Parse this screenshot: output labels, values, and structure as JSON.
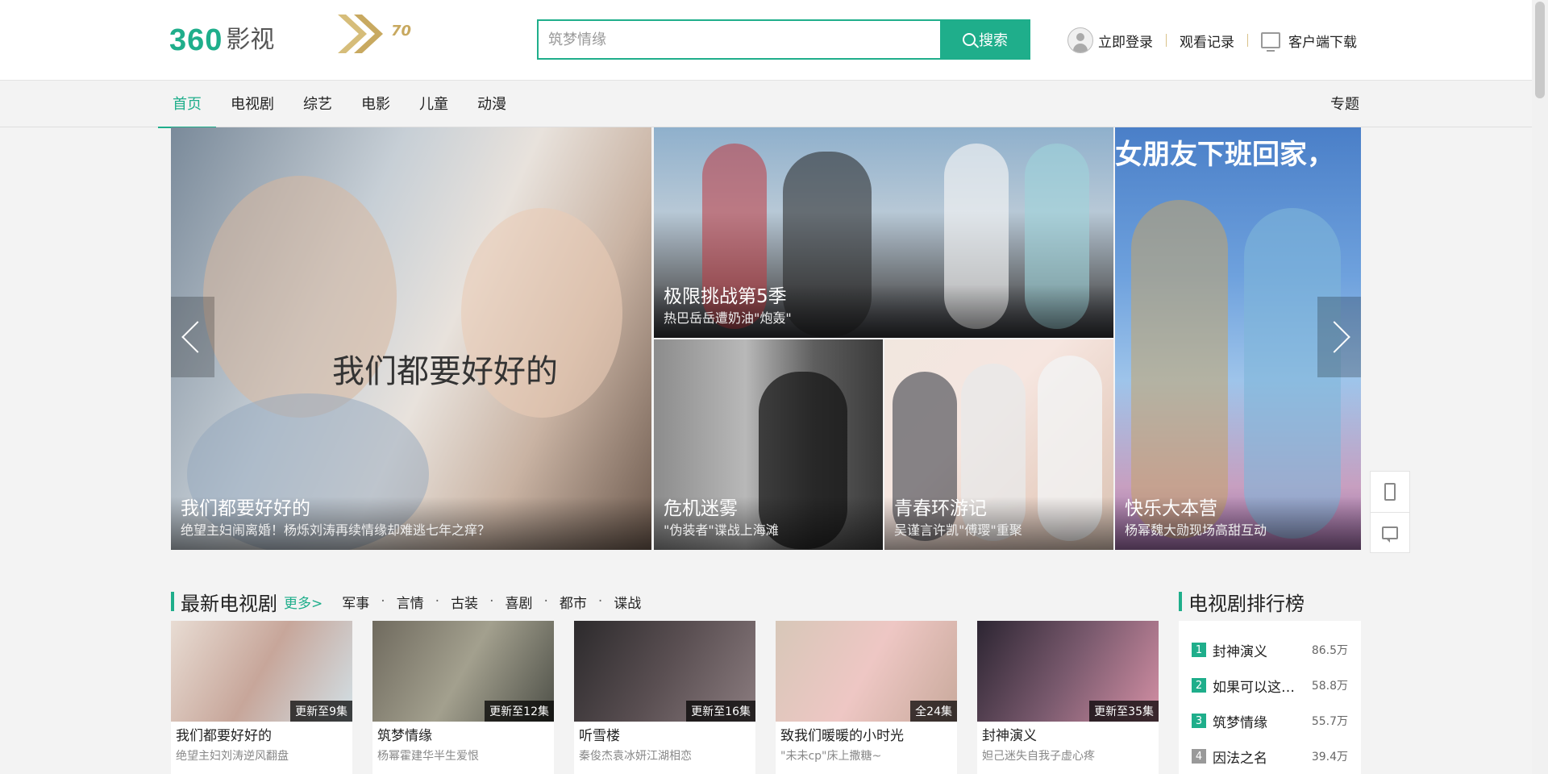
{
  "header": {
    "logo_number": "360",
    "logo_text": "影视",
    "anniversary_number": "70",
    "search_placeholder": "筑梦情缘",
    "search_button": "搜索",
    "login": "立即登录",
    "history": "观看记录",
    "download": "客户端下载"
  },
  "nav": {
    "items": [
      {
        "label": "首页"
      },
      {
        "label": "电视剧"
      },
      {
        "label": "综艺"
      },
      {
        "label": "电影"
      },
      {
        "label": "儿童"
      },
      {
        "label": "动漫"
      }
    ],
    "special": "专题"
  },
  "hero": {
    "main": {
      "title": "我们都要好好的",
      "subtitle": "绝望主妇闹离婚！杨烁刘涛再续情缘却难逃七年之痒？",
      "overlay_text": "我们都要好好的"
    },
    "top": {
      "title": "极限挑战第5季",
      "subtitle": "热巴岳岳遭奶油\"炮轰\""
    },
    "bottom_left": {
      "title": "危机迷雾",
      "subtitle": "\"伪装者\"谍战上海滩"
    },
    "bottom_mid": {
      "title": "青春环游记",
      "subtitle": "吴谨言许凯\"傅璎\"重聚"
    },
    "right": {
      "title": "快乐大本营",
      "subtitle": "杨幂魏大勋现场高甜互动",
      "overlay_text": "女朋友下班回家，"
    }
  },
  "latest": {
    "title": "最新电视剧",
    "more": "更多>",
    "tags": [
      "军事",
      "言情",
      "古装",
      "喜剧",
      "都市",
      "谍战"
    ],
    "cards": [
      {
        "title": "我们都要好好的",
        "sub": "绝望主妇刘涛逆风翻盘",
        "ep": "更新至9集"
      },
      {
        "title": "筑梦情缘",
        "sub": "杨幂霍建华半生爱恨",
        "ep": "更新至12集"
      },
      {
        "title": "听雪楼",
        "sub": "秦俊杰袁冰妍江湖相恋",
        "ep": "更新至16集"
      },
      {
        "title": "致我们暖暖的小时光",
        "sub": "\"未未cp\"床上撒糖~",
        "ep": "全24集"
      },
      {
        "title": "封神演义",
        "sub": "妲己迷失自我子虚心疼",
        "ep": "更新至35集"
      }
    ]
  },
  "ranking": {
    "title": "电视剧排行榜",
    "items": [
      {
        "num": "1",
        "name": "封神演义",
        "value": "86.5万"
      },
      {
        "num": "2",
        "name": "如果可以这…",
        "value": "58.8万"
      },
      {
        "num": "3",
        "name": "筑梦情缘",
        "value": "55.7万"
      },
      {
        "num": "4",
        "name": "因法之名",
        "value": "39.4万"
      }
    ]
  },
  "colors": {
    "accent": "#1fae8b",
    "rank_top": "#1fae8b",
    "rank_other": "#999999"
  }
}
